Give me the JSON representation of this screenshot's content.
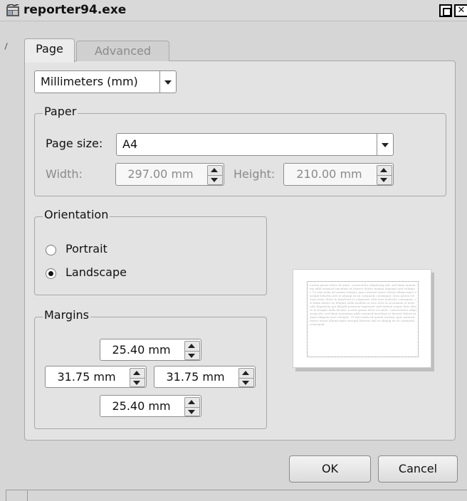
{
  "window": {
    "title": "reporter94.exe",
    "app_icon": "app-icon",
    "maximize_icon": "maximize-icon",
    "close_icon": "close-icon",
    "close_glyph": "✕"
  },
  "tabs": [
    {
      "label": "Page",
      "active": true
    },
    {
      "label": "Advanced",
      "active": false
    }
  ],
  "units": {
    "selected": "Millimeters (mm)"
  },
  "paper": {
    "group_label": "Paper",
    "page_size_label": "Page size:",
    "page_size_value": "A4",
    "width_label": "Width:",
    "width_value": "297.00 mm",
    "height_label": "Height:",
    "height_value": "210.00 mm"
  },
  "orientation": {
    "group_label": "Orientation",
    "options": [
      {
        "label": "Portrait",
        "checked": false
      },
      {
        "label": "Landscape",
        "checked": true
      }
    ]
  },
  "margins": {
    "group_label": "Margins",
    "top": "25.40 mm",
    "left": "31.75 mm",
    "right": "31.75 mm",
    "bottom": "25.40 mm"
  },
  "buttons": {
    "ok": "OK",
    "cancel": "Cancel"
  },
  "preview_text": "Lorem ipsum dolor sit amet, consectetur adipiscing elit, sed diam nonummy nibh euismod tincidunt ut laoreet dolore magna aliquam erat volutpat. Ut wisi enim ad minim veniam, quis nostrud exerci tation ullamcorper suscipit lobortis nisl ut aliquip ex ea commodo consequat. Duis autem vel eum iriure dolor in hendrerit in vulputate velit esse molestie consequat, vel illum dolore eu feugiat nulla facilisis at vero eros et accumsan et iusto odio dignissim qui blandit praesent luptatum zzril delenit augue duis dolore te feugait nulla facilisi. Lorem ipsum dolor sit amet, consectetuer adipiscing elit, sed diam nonummy nibh euismod tincidunt ut laoreet dolore magna aliquam erat volutpat. Ut wisi enim ad minim veniam, quis nostrud exerci tation ullamcorper suscipit lobortis nisl ut aliquip ex ea commodo consequat."
}
